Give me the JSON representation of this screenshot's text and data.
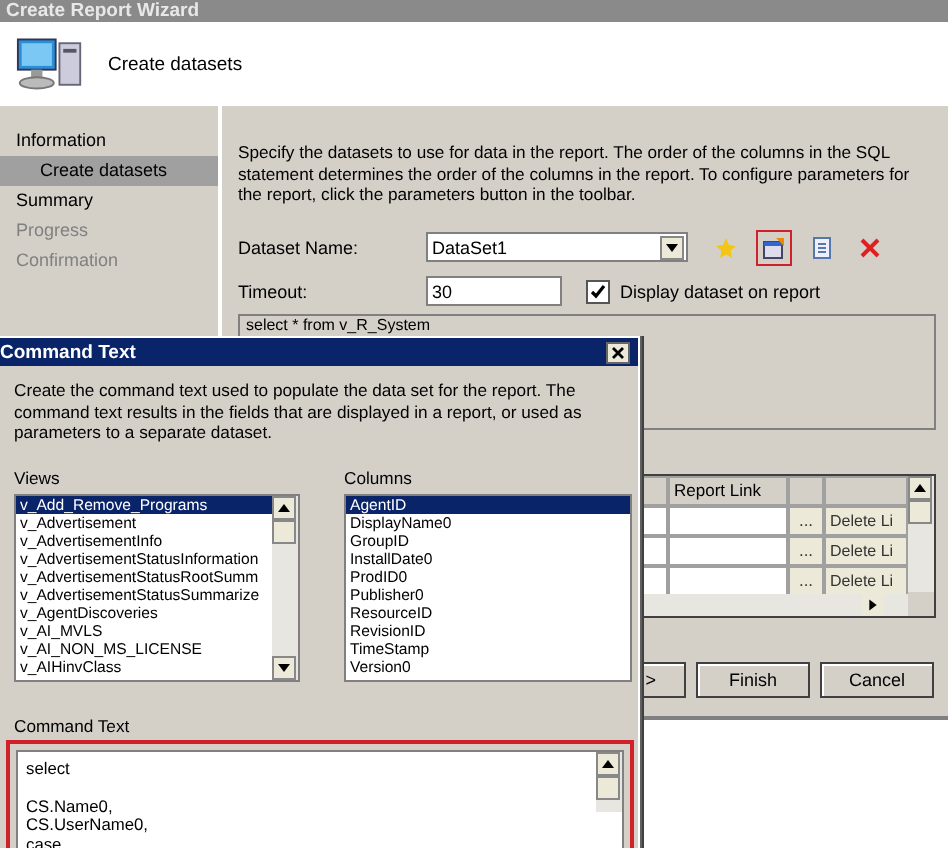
{
  "wizard": {
    "title": "Create Report Wizard",
    "header_title": "Create datasets",
    "steps": [
      {
        "label": "Information",
        "selected": false,
        "disabled": false,
        "children": [
          {
            "label": "Create datasets",
            "selected": true,
            "disabled": false
          }
        ]
      },
      {
        "label": "Summary",
        "selected": false,
        "disabled": false
      },
      {
        "label": "Progress",
        "selected": false,
        "disabled": true
      },
      {
        "label": "Confirmation",
        "selected": false,
        "disabled": true
      }
    ],
    "description": "Specify the datasets to use for data in the report. The order of the columns in the SQL statement determines the order of the columns in the report. To configure parameters for the report, click the parameters button in the toolbar.",
    "dataset_name": {
      "label": "Dataset Name:",
      "value": "DataSet1"
    },
    "timeout": {
      "label": "Timeout:",
      "value": "30"
    },
    "display_dataset": {
      "label": "Display dataset on report",
      "checked": true
    },
    "toolbar": [
      {
        "kind": "new",
        "highlighted": false
      },
      {
        "kind": "edit",
        "highlighted": true
      },
      {
        "kind": "page",
        "highlighted": false
      },
      {
        "kind": "delete",
        "highlighted": false
      }
    ],
    "query_text": "select * from v_R_System",
    "grid": {
      "columns": [
        "Report Link"
      ],
      "rows": [
        {
          "browse": "...",
          "delete": "Delete Li"
        },
        {
          "browse": "...",
          "delete": "Delete Li"
        },
        {
          "browse": "...",
          "delete": "Delete Li"
        }
      ]
    },
    "buttons": [
      ">",
      "Finish",
      "Cancel"
    ]
  },
  "dialog": {
    "title": "Command Text",
    "description": "Create the command text used to populate the data set for the report. The command text results in the fields that are displayed in a report, or used as parameters to a separate dataset.",
    "views_label": "Views",
    "views": [
      {
        "label": "v_Add_Remove_Programs",
        "selected": true
      },
      {
        "label": "v_Advertisement",
        "selected": false
      },
      {
        "label": "v_AdvertisementInfo",
        "selected": false
      },
      {
        "label": "v_AdvertisementStatusInformation",
        "selected": false
      },
      {
        "label": "v_AdvertisementStatusRootSumm",
        "selected": false
      },
      {
        "label": "v_AdvertisementStatusSummarize",
        "selected": false
      },
      {
        "label": "v_AgentDiscoveries",
        "selected": false
      },
      {
        "label": "v_AI_MVLS",
        "selected": false
      },
      {
        "label": "v_AI_NON_MS_LICENSE",
        "selected": false
      },
      {
        "label": "v_AIHinvClass",
        "selected": false
      }
    ],
    "columns_label": "Columns",
    "columns": [
      {
        "label": "AgentID",
        "selected": true
      },
      {
        "label": "DisplayName0",
        "selected": false
      },
      {
        "label": "GroupID",
        "selected": false
      },
      {
        "label": "InstallDate0",
        "selected": false
      },
      {
        "label": "ProdID0",
        "selected": false
      },
      {
        "label": "Publisher0",
        "selected": false
      },
      {
        "label": "ResourceID",
        "selected": false
      },
      {
        "label": "RevisionID",
        "selected": false
      },
      {
        "label": "TimeStamp",
        "selected": false
      },
      {
        "label": "Version0",
        "selected": false
      }
    ],
    "command_text_label": "Command Text",
    "command_text_highlighted": true,
    "command_text": "select\n\nCS.Name0,\nCS.UserName0,\ncase"
  }
}
